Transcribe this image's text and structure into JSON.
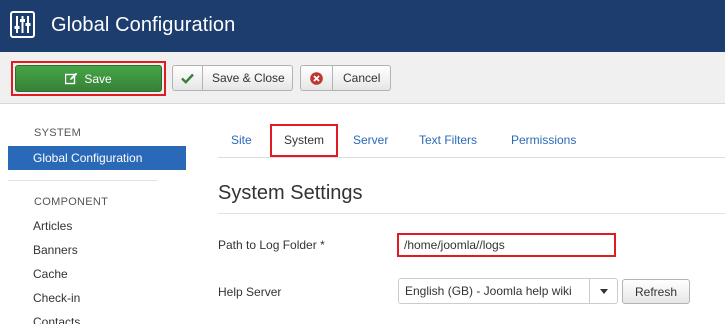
{
  "header": {
    "title": "Global Configuration",
    "icon": "equalizer-icon",
    "background_color": "#1c3d6e"
  },
  "toolbar": {
    "save_label": "Save",
    "save_icon": "edit-icon",
    "save_close_label": "Save & Close",
    "save_close_icon": "checkmark-icon",
    "cancel_label": "Cancel",
    "cancel_icon": "cancel-circle-icon",
    "save_color": "#46a546"
  },
  "sidebar": {
    "system_heading": "SYSTEM",
    "active_item": "Global Configuration",
    "component_heading": "COMPONENT",
    "component_items": [
      "Articles",
      "Banners",
      "Cache",
      "Check-in",
      "Contacts"
    ],
    "active_color": "#2a69b8"
  },
  "tabs": [
    {
      "label": "Site",
      "active": false
    },
    {
      "label": "System",
      "active": true
    },
    {
      "label": "Server",
      "active": false
    },
    {
      "label": "Text Filters",
      "active": false
    },
    {
      "label": "Permissions",
      "active": false
    }
  ],
  "main": {
    "section_title": "System Settings",
    "fields": {
      "log_folder": {
        "label": "Path to Log Folder *",
        "value": "/home/joomla//logs"
      },
      "help_server": {
        "label": "Help Server",
        "value": "English (GB) - Joomla help wiki",
        "refresh_label": "Refresh"
      }
    }
  },
  "highlight_color": "#e01b24"
}
